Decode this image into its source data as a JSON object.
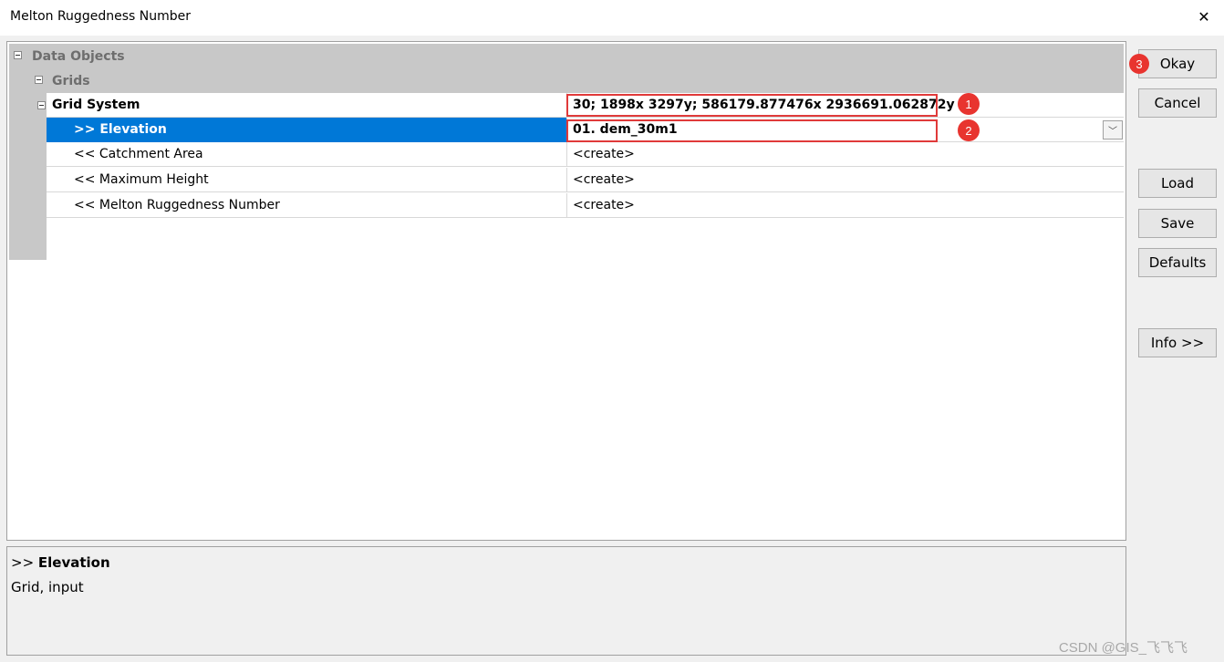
{
  "window": {
    "title": "Melton Ruggedness Number",
    "close_glyph": "✕"
  },
  "tree": {
    "data_objects_label": "Data Objects",
    "grids_label": "Grids",
    "grid_system": {
      "label": "Grid System",
      "value": "30; 1898x 3297y; 586179.877476x 2936691.062872y"
    },
    "rows": [
      {
        "name": ">> Elevation",
        "value": "01. dem_30m1"
      },
      {
        "name": "<< Catchment Area",
        "value": "<create>"
      },
      {
        "name": "<< Maximum Height",
        "value": "<create>"
      },
      {
        "name": "<< Melton Ruggedness Number",
        "value": "<create>"
      }
    ],
    "dropdown_glyph": "﹀"
  },
  "badges": [
    "1",
    "2",
    "3"
  ],
  "buttons": {
    "okay": "Okay",
    "cancel": "Cancel",
    "load": "Load",
    "save": "Save",
    "defaults": "Defaults",
    "info": "Info >>"
  },
  "description": {
    "prefix": ">> ",
    "title": "Elevation",
    "text": "Grid, input"
  },
  "watermark": "CSDN @GIS_飞飞飞",
  "colors": {
    "selection": "#0078d7",
    "annotation_red": "#e03a3a",
    "group_header": "#c8c8c8"
  }
}
